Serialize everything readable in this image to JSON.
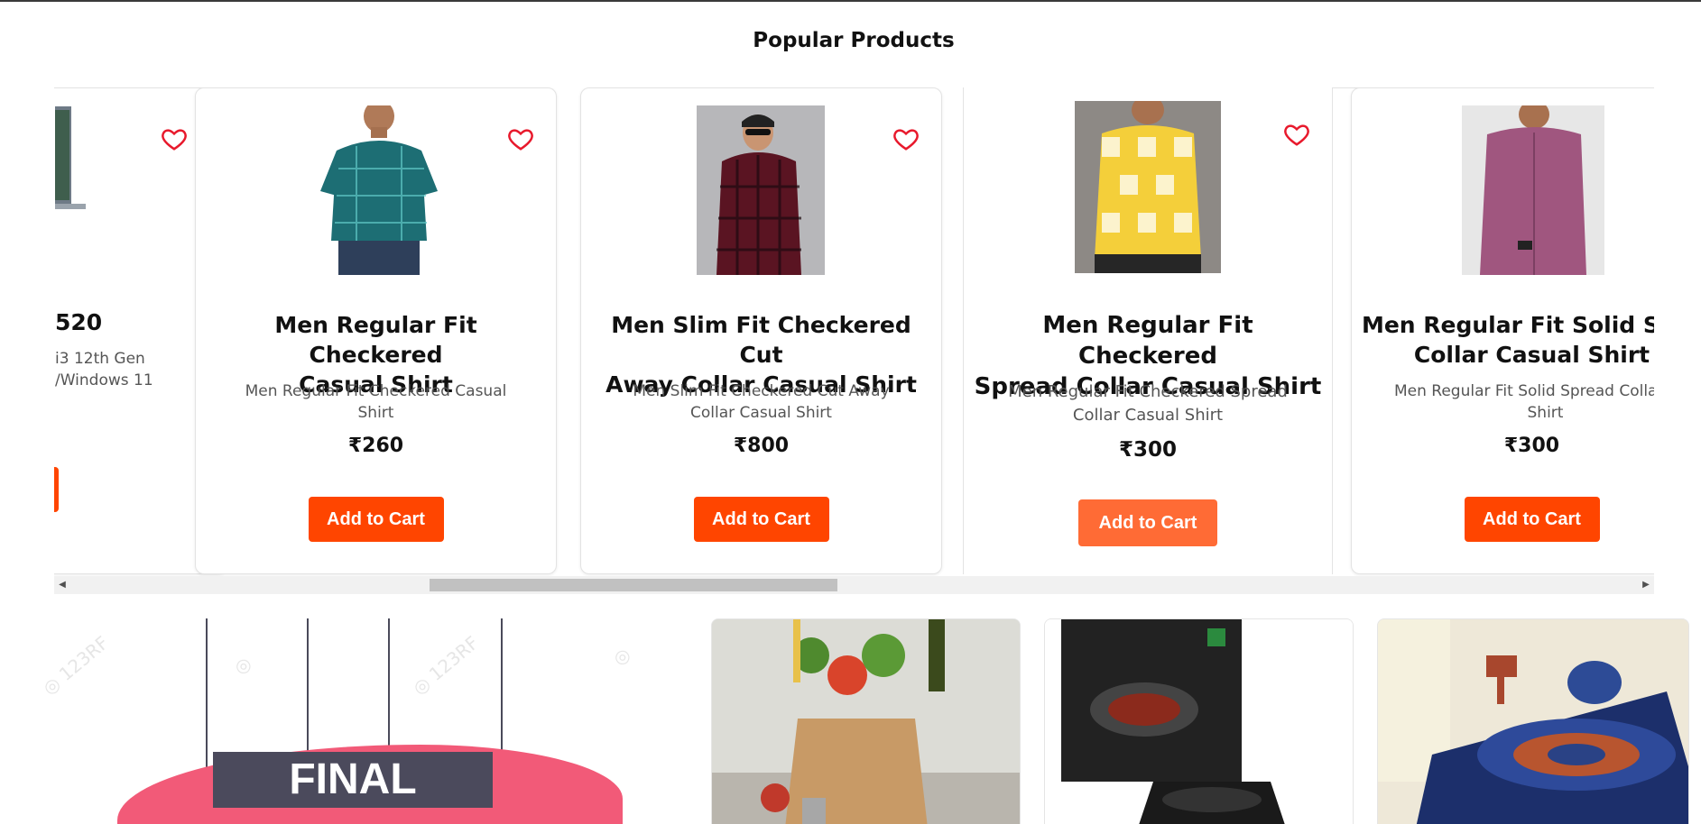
{
  "section": {
    "title": "Popular Products"
  },
  "partial_card": {
    "title_fragment": "520",
    "desc_line1": "i3 12th Gen",
    "desc_line2": "/Windows 11"
  },
  "products": [
    {
      "title": "Men Regular Fit Checkered\nCasual Shirt",
      "description": "Men Regular Fit Checkered Casual Shirt",
      "price": "₹260",
      "button": "Add to Cart",
      "shirt_color": "#1d6e74"
    },
    {
      "title": "Men Slim Fit Checkered Cut\nAway Collar Casual Shirt",
      "description": "Men Slim Fit Checkered Cut Away Collar Casual Shirt",
      "price": "₹800",
      "button": "Add to Cart",
      "shirt_color": "#5a1422"
    },
    {
      "title": "Men Regular Fit Checkered\nSpread Collar Casual Shirt",
      "description": "Men Regular Fit Checkered Spread Collar Casual Shirt",
      "price": "₹300",
      "button": "Add to Cart",
      "shirt_color": "#f4cf3a"
    },
    {
      "title": "Men Regular Fit Solid Spre\nCollar Casual Shirt",
      "description": "Men Regular Fit Solid Spread Collar Cas Shirt",
      "price": "₹300",
      "button": "Add to Cart",
      "shirt_color": "#a0567f"
    }
  ],
  "banner": {
    "text": "FINAL"
  },
  "colors": {
    "accent": "#ff4500",
    "accent_hover": "#ff6b35",
    "heart": "#e8192c"
  }
}
